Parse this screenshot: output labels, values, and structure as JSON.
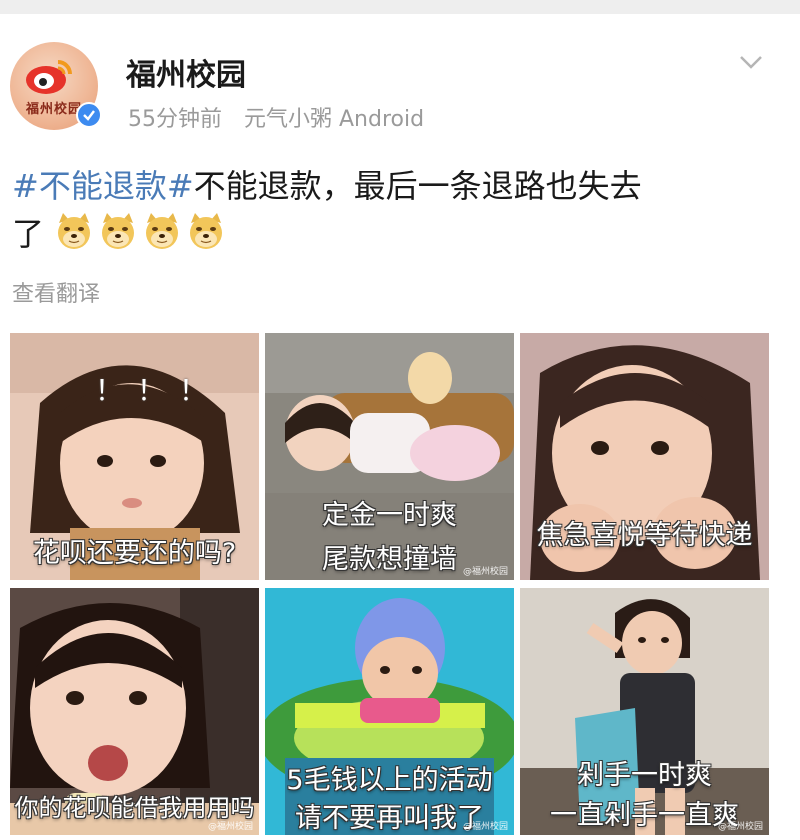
{
  "post": {
    "user_name": "福州校园",
    "avatar_text": "福州校园",
    "time": "55分钟前",
    "source": "元气小粥 Android",
    "hashtag": "#不能退款#",
    "text_line1": "不能退款，最后一条退路也失去",
    "text_line2": "了",
    "emoji_count": 4,
    "translate_label": "查看翻译"
  },
  "images": [
    {
      "caption": "花呗还要还的吗?",
      "extra": "！！！",
      "watermark": ""
    },
    {
      "caption": "定金一时爽",
      "caption2": "尾款想撞墙",
      "watermark": "@福州校园"
    },
    {
      "caption": "焦急喜悦等待快递",
      "watermark": ""
    },
    {
      "caption": "你的花呗能借我用用吗",
      "watermark": "@福州校园"
    },
    {
      "caption": "5毛钱以上的活动",
      "caption2": "请不要再叫我了",
      "watermark": "@福州校园"
    },
    {
      "caption": "剁手一时爽",
      "caption2": "一直剁手一直爽",
      "watermark": "@福州校园"
    }
  ],
  "icons": {
    "verified": "verified-badge-icon",
    "menu": "chevron-down-icon",
    "emoji": "doge-emoji-icon"
  },
  "colors": {
    "hashtag": "#4a7bb7",
    "meta": "#9a9a9a",
    "verified": "#3d8bf0"
  }
}
